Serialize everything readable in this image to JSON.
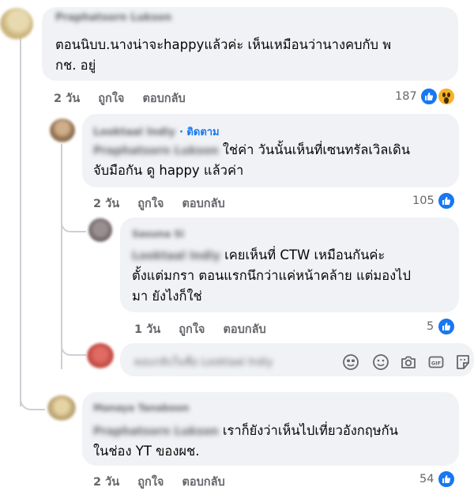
{
  "comments": [
    {
      "author": "Praphatsorn Lukson",
      "line1": "ตอนนิบบ.นางน่าจะhappyแล้วค่ะ เห็นเหมือนว่านางคบกับ พ",
      "line2": "กช. อยู่",
      "time": "2 วัน",
      "like": "ถูกใจ",
      "reply": "ตอบกลับ",
      "reaction_count": "187"
    },
    {
      "author": "Looktaal Indiy",
      "follow": "· ติดตาม",
      "mention": "Praphatsorn Lukson",
      "line1_rest": "ใช่ค่า วันนั้นเห็นที่เซนทรัลเวิลเดิน",
      "line2": "จับมือกัน ดู happy แล้วค่า",
      "time": "2 วัน",
      "like": "ถูกใจ",
      "reply": "ตอบกลับ",
      "reaction_count": "105"
    },
    {
      "author": "Sasuna Si",
      "mention": "Looktaal Indiy",
      "line1_rest": "เคยเห็นที่ CTW เหมือนกันค่ะ",
      "line2": "ตั้งแต่มกรา ตอนแรกนึกว่าแค่หน้าคล้าย แต่มองไป",
      "line3": "มา ยังไงก็ใช่",
      "time": "1 วัน",
      "like": "ถูกใจ",
      "reply": "ตอบกลับ",
      "reaction_count": "5"
    },
    {
      "author": "Manaya Tanaboon",
      "mention": "Praphatsorn Lukson",
      "line1_rest": "เราก็ยังว่าเห็นไปเที่ยวอังกฤษกัน",
      "line2": "ในช่อง YT ของผช.",
      "time": "2 วัน",
      "like": "ถูกใจ",
      "reply": "ตอบกลับ",
      "reaction_count": "54"
    }
  ],
  "reply_box": {
    "placeholder": "ตอบกลับในชื่อ Looktaal Indiy",
    "icons": [
      "sticker-face-icon",
      "emoji-icon",
      "camera-icon",
      "gif-icon",
      "sticker-icon"
    ]
  },
  "colors": {
    "bubble": "#f0f2f5",
    "meta_text": "#65676b",
    "like_blue": "#1877f2",
    "wow_yellow": "#f7b125"
  }
}
